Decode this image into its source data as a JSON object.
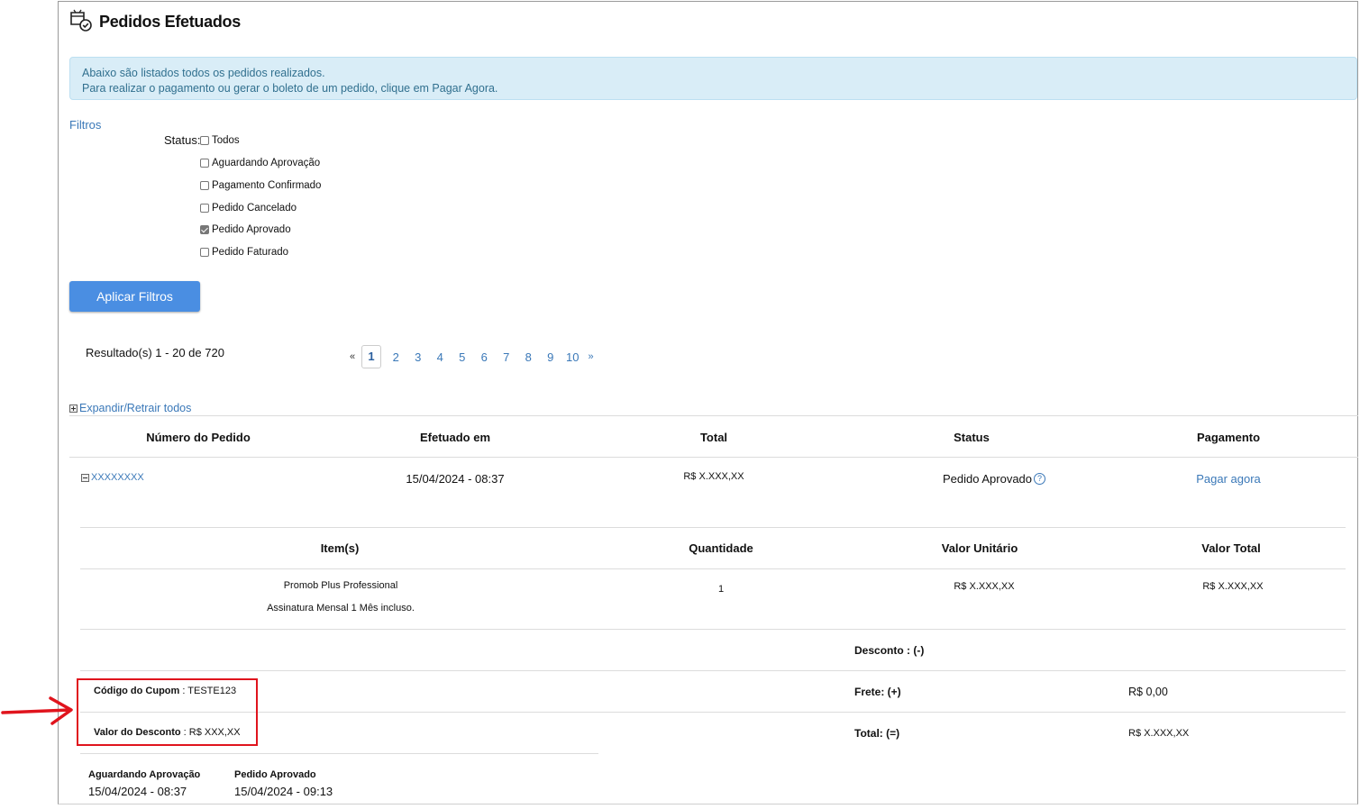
{
  "page": {
    "title": "Pedidos Efetuados",
    "info_line1": "Abaixo são listados todos os pedidos realizados.",
    "info_line2": "Para realizar o pagamento ou gerar o boleto de um pedido, clique em Pagar Agora."
  },
  "filters": {
    "title": "Filtros",
    "status_label": "Status:",
    "options": [
      {
        "label": "Todos",
        "checked": false
      },
      {
        "label": "Aguardando Aprovação",
        "checked": false
      },
      {
        "label": "Pagamento Confirmado",
        "checked": false
      },
      {
        "label": "Pedido Cancelado",
        "checked": false
      },
      {
        "label": "Pedido Aprovado",
        "checked": true
      },
      {
        "label": "Pedido Faturado",
        "checked": false
      }
    ],
    "apply_label": "Aplicar Filtros"
  },
  "results": {
    "summary": "Resultado(s) 1 - 20 de 720",
    "prev": "«",
    "next": "»",
    "pages": [
      "1",
      "2",
      "3",
      "4",
      "5",
      "6",
      "7",
      "8",
      "9",
      "10"
    ],
    "current_page": "1"
  },
  "orders": {
    "expand_label": "Expandir/Retrair todos",
    "headers": [
      "Número do Pedido",
      "Efetuado em",
      "Total",
      "Status",
      "Pagamento"
    ],
    "row": {
      "number": "XXXXXXXX",
      "date": "15/04/2024 - 08:37",
      "total": "R$ X.XXX,XX",
      "status": "Pedido Aprovado",
      "help_icon": "?",
      "payment_link": "Pagar agora"
    }
  },
  "details": {
    "headers": [
      "Item(s)",
      "Quantidade",
      "Valor Unitário",
      "Valor Total"
    ],
    "item": {
      "name": "Promob Plus Professional",
      "description": "Assinatura Mensal 1 Mês incluso.",
      "quantity": "1",
      "unit_price": "R$ X.XXX,XX",
      "total_price": "R$ X.XXX,XX"
    },
    "discount_label": "Desconto : (-)",
    "coupon_label": "Código do Cupom",
    "coupon_value": " : TESTE123",
    "freight_label": "Frete: (+)",
    "freight_value": "R$ 0,00",
    "discount_value_label": "Valor do Desconto",
    "discount_value": " : R$ XXX,XX",
    "total_label": "Total: (=)",
    "total_value": "R$ X.XXX,XX"
  },
  "history": [
    {
      "label": "Aguardando Aprovação",
      "date": "15/04/2024 - 08:37"
    },
    {
      "label": "Pedido Aprovado",
      "date": "15/04/2024 - 09:13"
    }
  ],
  "colors": {
    "link": "#3a78b8",
    "button": "#4a8ee2",
    "info_bg": "#d9edf7",
    "info_text": "#31708f",
    "highlight": "#e0141d"
  }
}
